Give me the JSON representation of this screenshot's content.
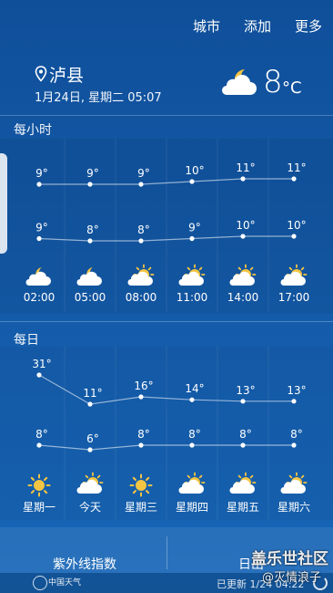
{
  "nav": {
    "city": "城市",
    "add": "添加",
    "more": "更多"
  },
  "location": {
    "name": "泸县",
    "date": "1月24日, 星期二 05:07"
  },
  "current": {
    "temp": "8",
    "unit": "°C",
    "icon": "cloud-moon-icon"
  },
  "hourly": {
    "title": "每小时",
    "highs": [
      "9°",
      "9°",
      "9°",
      "10°",
      "11°",
      "11°"
    ],
    "lows": [
      "9°",
      "8°",
      "8°",
      "9°",
      "10°",
      "10°"
    ],
    "high_values": [
      9,
      9,
      9,
      10,
      11,
      11
    ],
    "low_values": [
      9,
      8,
      8,
      9,
      10,
      10
    ],
    "icons": [
      "cloud-moon-icon",
      "cloud-moon-icon",
      "cloud-sun-icon",
      "cloud-sun-icon",
      "cloud-sun-icon",
      "cloud-sun-icon"
    ],
    "times": [
      "02:00",
      "05:00",
      "08:00",
      "11:00",
      "14:00",
      "17:00"
    ]
  },
  "daily": {
    "title": "每日",
    "highs": [
      "31°",
      "11°",
      "16°",
      "14°",
      "13°",
      "13°"
    ],
    "lows": [
      "8°",
      "6°",
      "8°",
      "8°",
      "8°",
      "8°"
    ],
    "high_values": [
      31,
      11,
      16,
      14,
      13,
      13
    ],
    "low_values": [
      8,
      6,
      8,
      8,
      8,
      8
    ],
    "icons": [
      "sun-icon",
      "cloud-sun-icon",
      "sun-icon",
      "cloud-sun-icon",
      "cloud-sun-icon",
      "cloud-sun-icon"
    ],
    "days": [
      "星期一",
      "今天",
      "星期三",
      "星期四",
      "星期五",
      "星期六"
    ]
  },
  "tiles": {
    "uv": "紫外线指数",
    "sunrise": "日出"
  },
  "footer": {
    "logo": "中国天气",
    "updated": "已更新 1/24 04:22"
  },
  "watermark": {
    "line1": "盖乐世社区",
    "line2": "@灭情浪子"
  }
}
